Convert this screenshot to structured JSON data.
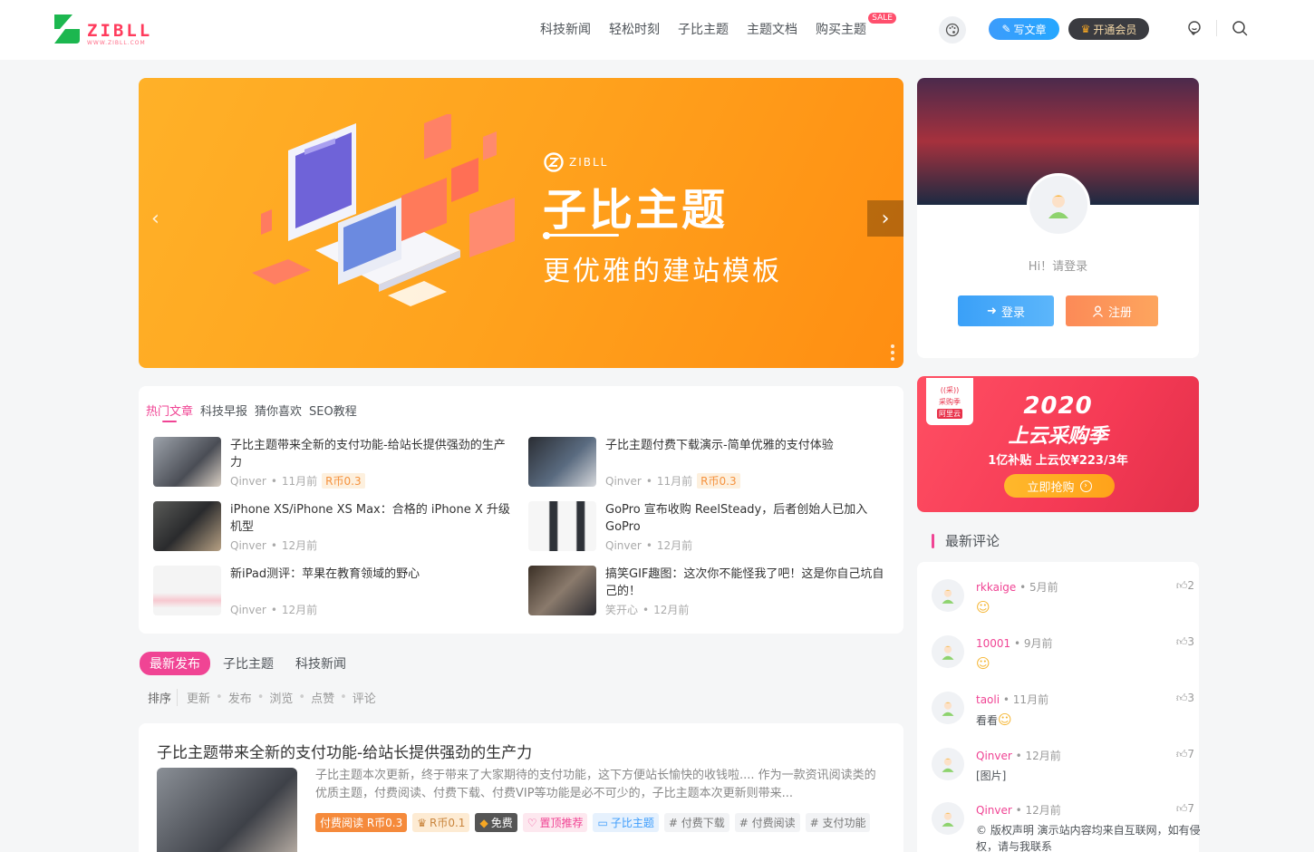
{
  "header": {
    "logo_text": "ZIBLL",
    "logo_sub": "WWW.ZIBLL.COM",
    "nav": [
      "科技新闻",
      "轻松时刻",
      "子比主题",
      "主题文档",
      "购买主题"
    ],
    "sale_badge": "SALE",
    "write_label": "写文章",
    "vip_label": "开通会员",
    "colors": {
      "accent": "#f04494",
      "brand_green": "#1cb74f",
      "brand_red": "#ff3b5c"
    }
  },
  "banner": {
    "brand": "ZIBLL",
    "title": "子比主题",
    "subtitle": "更优雅的建站模板",
    "prev_icon": "‹",
    "next_icon": "›"
  },
  "user_card": {
    "greeting": "Hi！请登录",
    "login_label": "登录",
    "register_label": "注册"
  },
  "ad": {
    "badge_top": "((采))",
    "badge_mid": "采购季",
    "badge_bot": "阿里云",
    "year": "2020",
    "title": "上云采购季",
    "subtitle": "1亿补贴 上云仅¥223/3年",
    "button": "立即抢购"
  },
  "hot": {
    "tabs": [
      "热门文章",
      "科技早报",
      "猜你喜欢",
      "SEO教程"
    ],
    "posts": [
      {
        "title": "子比主题带来全新的支付功能-给站长提供强劲的生产力",
        "author": "Qinver",
        "time": "11月前",
        "price": "R币0.3"
      },
      {
        "title": "子比主题付费下载演示-简单优雅的支付体验",
        "author": "Qinver",
        "time": "11月前",
        "price": "R币0.3"
      },
      {
        "title": "iPhone XS/iPhone XS Max：合格的 iPhone X 升级机型",
        "author": "Qinver",
        "time": "12月前",
        "price": ""
      },
      {
        "title": "GoPro 宣布收购 ReelSteady，后者创始人已加入 GoPro",
        "author": "Qinver",
        "time": "12月前",
        "price": ""
      },
      {
        "title": "新iPad测评：苹果在教育领域的野心",
        "author": "Qinver",
        "time": "12月前",
        "price": ""
      },
      {
        "title": "搞笑GIF趣图：这次你不能怪我了吧！这是你自己坑自己的！",
        "author": "笑开心",
        "time": "12月前",
        "price": ""
      }
    ]
  },
  "latest": {
    "tabs": [
      "最新发布",
      "子比主题",
      "科技新闻"
    ],
    "sort_label": "排序",
    "sort_options": [
      "更新",
      "发布",
      "浏览",
      "点赞",
      "评论"
    ]
  },
  "post": {
    "title": "子比主题带来全新的支付功能-给站长提供强劲的生产力",
    "excerpt": "子比主题本次更新，终于带来了大家期待的支付功能，这下方便站长愉快的收钱啦.... 作为一款资讯阅读类的优质主题，付费阅读、付费下载、付费VIP等功能是必不可少的，子比主题本次更新则带来...",
    "tags": [
      "付费阅读 R币0.3",
      "R币0.1",
      "免费",
      "置顶推荐",
      "子比主题",
      "# 付费下载",
      "# 付费阅读",
      "# 支付功能"
    ]
  },
  "comments": {
    "heading": "最新评论",
    "items": [
      {
        "name": "rkkaige",
        "time": "5月前",
        "likes": "2",
        "text": ""
      },
      {
        "name": "10001",
        "time": "9月前",
        "likes": "3",
        "text": ""
      },
      {
        "name": "taoli",
        "time": "11月前",
        "likes": "3",
        "text": "看看"
      },
      {
        "name": "Qinver",
        "time": "12月前",
        "likes": "7",
        "text": "[图片]"
      },
      {
        "name": "Qinver",
        "time": "12月前",
        "likes": "7",
        "text": "© 版权声明 演示站内容均来自互联网，如有侵权，请与我联系"
      }
    ]
  }
}
